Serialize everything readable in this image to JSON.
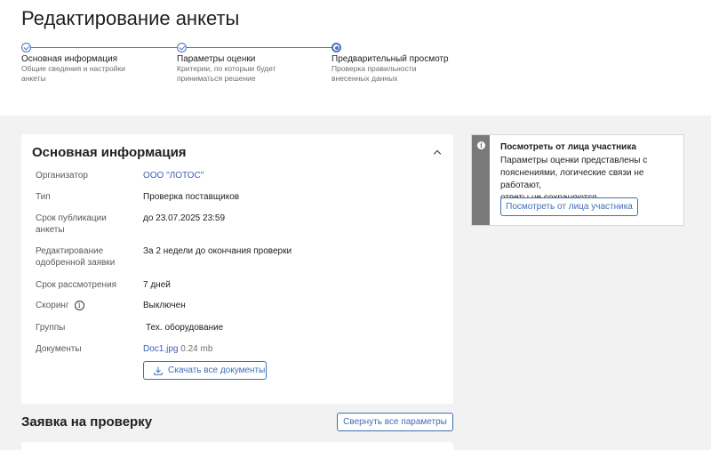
{
  "page_title": "Редактирование анкеты",
  "steps": [
    {
      "title": "Основная информация",
      "desc_lines": [
        "Общие сведения и настройки",
        "анкеты"
      ],
      "state": "done"
    },
    {
      "title": "Параметры оценки",
      "desc_lines": [
        "Критерии, по которым будет",
        "приниматься решение"
      ],
      "state": "done"
    },
    {
      "title": "Предварительный просмотр",
      "desc_lines": [
        "Проверка правильности",
        "внесенных данных"
      ],
      "state": "active"
    }
  ],
  "main_card": {
    "title": "Основная информация",
    "rows": {
      "organizer": {
        "label": "Организатор",
        "value": "ООО \"ЛОТОС\""
      },
      "type": {
        "label": "Тип",
        "value": "Проверка поставщиков"
      },
      "publication": {
        "label_lines": [
          "Срок публикации",
          "анкеты"
        ],
        "value": "до 23.07.2025 23:59"
      },
      "editing": {
        "label_lines": [
          "Редактирование",
          "одобренной заявки"
        ],
        "value": "За 2 недели до окончания проверки"
      },
      "review": {
        "label": "Срок рассмотрения",
        "value": "7 дней"
      },
      "scoring": {
        "label": "Скоринг",
        "value": "Выключен"
      },
      "groups": {
        "label": "Группы",
        "value": "Тех. оборудование"
      },
      "documents": {
        "label": "Документы",
        "file_name": "Doc1.jpg",
        "file_size": "0.24 mb"
      }
    },
    "download_all_label": "Скачать все документы"
  },
  "side_panel": {
    "title": "Посмотреть от лица участника",
    "text_lines": [
      "Параметры оценки представлены с",
      "пояснениями, логические связи не работают,",
      "ответы не сохраняются."
    ],
    "button_label": "Посмотреть от лица участника"
  },
  "section2": {
    "title": "Заявка на проверку",
    "collapse_button_label": "Свернуть все параметры"
  },
  "icons": {
    "accent_color": "#3f6fb3",
    "info": "info-icon",
    "download": "download-icon",
    "chevron": "chevron-up-icon"
  }
}
